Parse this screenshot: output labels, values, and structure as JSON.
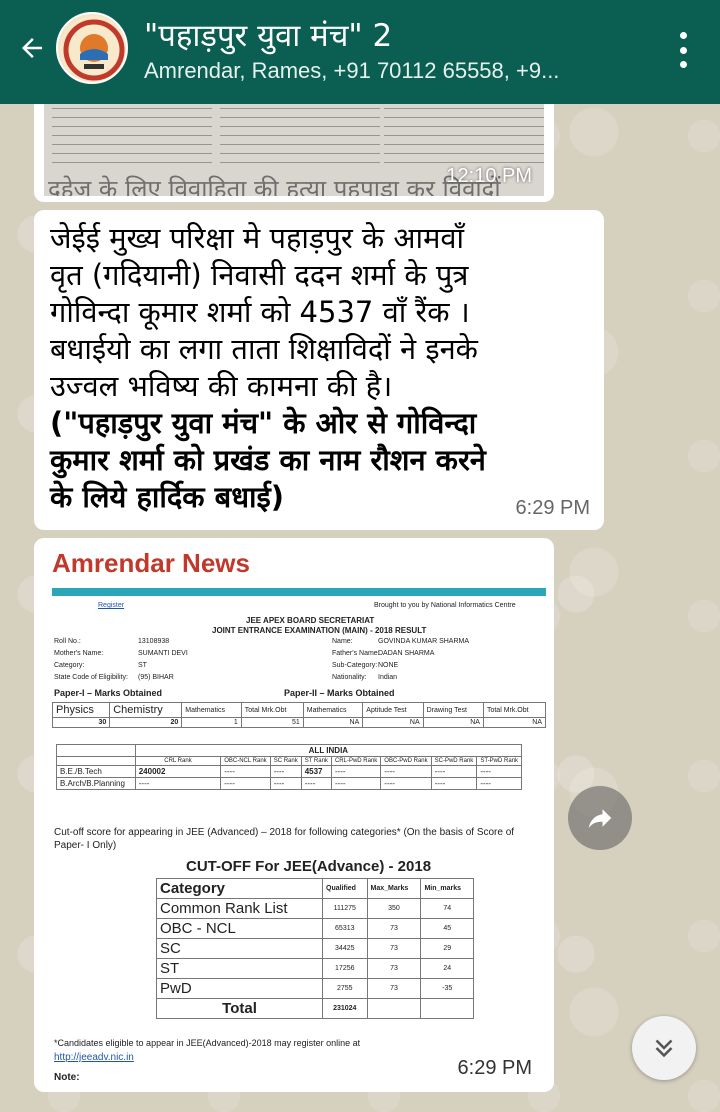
{
  "header": {
    "title": "\"पहाड़पुर युवा मंच\" 2",
    "participants": "Amrendar, Rames, +91 70112 65558, +9...",
    "avatar_icon": "group-avatar-icon",
    "back_icon": "arrow-left-icon",
    "menu_icon": "more-vert-icon",
    "bar_color": "#0b5e52"
  },
  "messages": {
    "image1": {
      "headline": "दहेज के लिए विवाहिता की हत्या   पहपाड़ा कर विवादों",
      "time": "12:10 PM"
    },
    "text": {
      "lines": [
        "जेईई मुख्य परिक्षा मे पहाड़पुर के आमवाँ",
        "वृत (गदियानी) निवासी ददन शर्मा के पुत्र",
        "गोविन्दा कूमार शर्मा को 4537 वाँ रैंक ।",
        "बधाईयो का लगा ताता शिक्षाविदों ने इनके",
        "उज्वल भविष्य की कामना की है।",
        "(\"पहाड़पुर युवा मंच\" के ओर से गोविन्दा",
        "कुमार शर्मा को प्रखंड का नाम रौशन करने",
        "के लिये हार्दिक बधाई)"
      ],
      "time": "6:29 PM"
    },
    "image2": {
      "news_title": "Amrendar News",
      "time": "6:29 PM",
      "doc": {
        "left_link": "Register",
        "right_note": "Brought to you by National Informatics Centre",
        "heading1": "JEE APEX BOARD SECRETARIAT",
        "heading2": "JOINT ENTRANCE EXAMINATION (MAIN) - 2018 RESULT",
        "roll_label": "Roll No.:",
        "roll_value": "13108938",
        "mother_label": "Mother's Name:",
        "mother_value": "SUMANTI DEVI",
        "category_label": "Category:",
        "category_value": "ST",
        "state_label": "State Code of Eligibility:",
        "state_value": "(95) BIHAR",
        "name_label": "Name:",
        "name_value": "GOVINDA KUMAR SHARMA",
        "father_label": "Father's Name:",
        "father_value": "DADAN SHARMA",
        "subcat_label": "Sub-Category:",
        "subcat_value": "NONE",
        "nationality_label": "Nationality:",
        "nationality_value": "Indian",
        "paper1": "Paper-I – Marks Obtained",
        "paper2": "Paper-II – Marks Obtained",
        "marks_headers": [
          "Physics",
          "Chemistry",
          "Mathematics",
          "Total Mrk.Obt",
          "Mathematics",
          "Aptitude Test",
          "Drawing Test",
          "Total Mrk.Obt"
        ],
        "marks_values": [
          "30",
          "20",
          "1",
          "51",
          "NA",
          "NA",
          "NA",
          "NA"
        ],
        "allindia": "ALL INDIA",
        "rank_headers": [
          "CRL Rank",
          "OBC-NCL Rank",
          "SC Rank",
          "ST Rank",
          "CRL-PwD Rank",
          "OBC-PwD Rank",
          "SC-PwD Rank",
          "ST-PwD Rank"
        ],
        "rank_rows": [
          {
            "label": "B.E./B.Tech",
            "values": [
              "240002",
              "----",
              "----",
              "4537",
              "----",
              "----",
              "----",
              "----"
            ]
          },
          {
            "label": "B.Arch/B.Planning",
            "values": [
              "----",
              "----",
              "----",
              "----",
              "----",
              "----",
              "----",
              "----"
            ]
          }
        ],
        "cutoff_note": "Cut-off score for appearing in JEE (Advanced) – 2018 for following categories* (On the basis of Score of Paper- I Only)",
        "cutoff_title": "CUT-OFF For JEE(Advance) - 2018",
        "cutoff_headers": [
          "Category",
          "Qualified",
          "Max_Marks",
          "Min_marks"
        ],
        "cutoff_rows": [
          [
            "Common Rank List",
            "111275",
            "350",
            "74"
          ],
          [
            "OBC - NCL",
            "65313",
            "73",
            "45"
          ],
          [
            "SC",
            "34425",
            "73",
            "29"
          ],
          [
            "ST",
            "17256",
            "73",
            "24"
          ],
          [
            "PwD",
            "2755",
            "73",
            "-35"
          ]
        ],
        "cutoff_total_label": "Total",
        "cutoff_total": "231024",
        "candidates_note": "*Candidates eligible to appear in JEE(Advanced)-2018 may register online at",
        "link": "http://jeeadv.nic.in",
        "note_label": "Note:"
      }
    }
  },
  "buttons": {
    "share_icon": "forward-share-icon",
    "scroll_icon": "double-chevron-down-icon"
  }
}
